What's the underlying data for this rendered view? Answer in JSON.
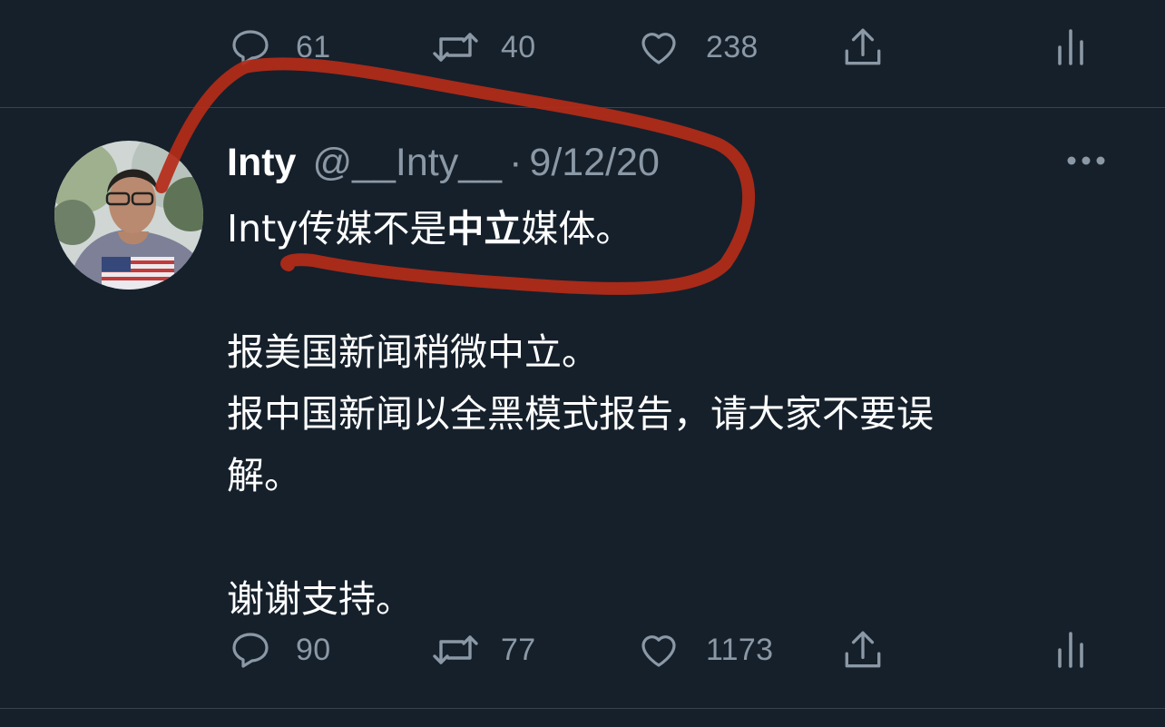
{
  "top_tweet": {
    "actions": {
      "reply_count": "61",
      "retweet_count": "40",
      "like_count": "238"
    }
  },
  "tweet": {
    "display_name": "Inty",
    "handle": "@__Inty__",
    "separator": "·",
    "date": "9/12/20",
    "line1_prefix": "Inty传媒不是",
    "line1_bold": "中立",
    "line1_suffix": "媒体。",
    "line2": "报美国新闻稍微中立。",
    "line3": "报中国新闻以全黑模式报告，请大家不要误",
    "line4": "解。",
    "line5": "谢谢支持。",
    "actions": {
      "reply_count": "90",
      "retweet_count": "77",
      "like_count": "1173"
    }
  },
  "colors": {
    "background": "#15202b",
    "muted": "#8b98a5",
    "divider": "#38444d",
    "annotation": "#b52b18"
  },
  "icons": [
    "reply-icon",
    "retweet-icon",
    "like-icon",
    "share-icon",
    "analytics-icon",
    "more-icon"
  ]
}
